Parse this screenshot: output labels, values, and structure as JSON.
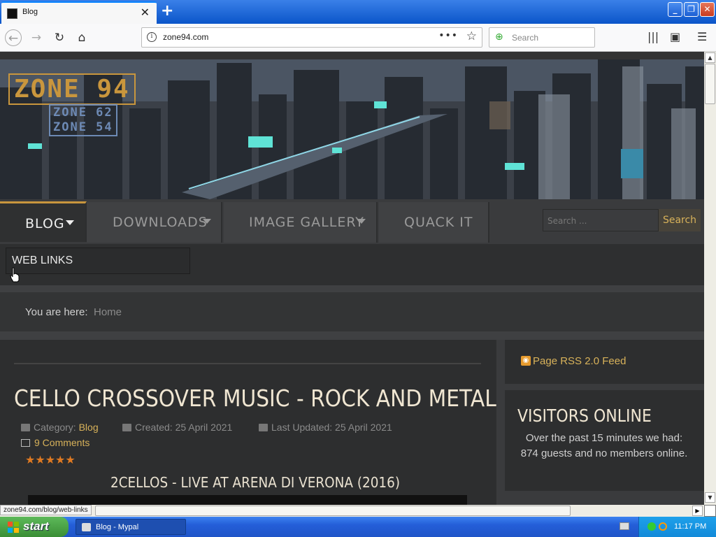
{
  "browser": {
    "tab_title": "Blog",
    "url": "zone94.com",
    "search_placeholder": "Search",
    "status_url": "zone94.com/blog/web-links"
  },
  "site": {
    "logo_main": "ZONE 94",
    "logo_sub1": "ZONE 62",
    "logo_sub2": "ZONE 54",
    "nav": {
      "blog": "BLOG",
      "downloads": "DOWNLOADS",
      "gallery": "IMAGE GALLERY",
      "quack": "QUACK IT"
    },
    "search_placeholder": "Search ...",
    "search_button": "Search",
    "submenu_item": "WEB LINKS",
    "breadcrumb_label": "You are here:",
    "breadcrumb_home": "Home"
  },
  "article": {
    "title": "CELLO CROSSOVER MUSIC - ROCK AND METAL",
    "category_label": "Category:",
    "category": "Blog",
    "created": "Created: 25 April 2021",
    "updated": "Last Updated: 25 April 2021",
    "comments": "9 Comments",
    "rating_stars": "★★★★★",
    "rating": 5,
    "video_title": "2CELLOS - LIVE AT ARENA DI VERONA (2016)"
  },
  "sidebar": {
    "rss": "Page RSS 2.0 Feed",
    "visitors_title": "VISITORS ONLINE",
    "visitors_text": "Over the past 15 minutes we had: 874 guests and no members online."
  },
  "taskbar": {
    "start": "start",
    "task_item": "Blog - Mypal",
    "time": "11:17 PM"
  },
  "colors": {
    "accent": "#d8b25a",
    "page_bg": "#2e2f30",
    "star": "#e07a22"
  }
}
